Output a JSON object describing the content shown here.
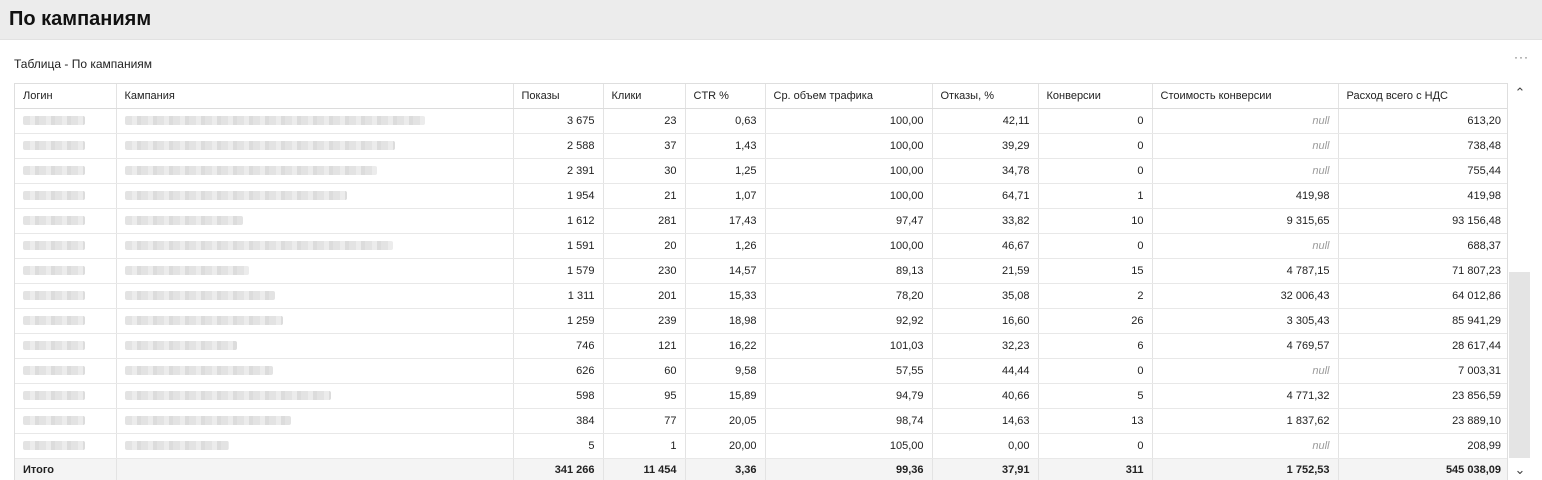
{
  "page": {
    "title": "По кампаниям",
    "subtitle": "Таблица - По кампаниям",
    "more_glyph": "···",
    "scroll_up_glyph": "⌃",
    "scroll_down_glyph": "⌄"
  },
  "table": {
    "columns": [
      "Логин",
      "Кампания",
      "Показы",
      "Клики",
      "CTR %",
      "Ср. объем трафика",
      "Отказы, %",
      "Конверсии",
      "Стоимость конверсии",
      "Расход всего с НДС"
    ],
    "rows": [
      {
        "login": "",
        "campaign": "",
        "shows": "3 675",
        "clicks": "23",
        "ctr": "0,63",
        "traffic": "100,00",
        "bounce": "42,11",
        "conversions": "0",
        "conv_cost": "null",
        "spend": "613,20"
      },
      {
        "login": "",
        "campaign": "",
        "shows": "2 588",
        "clicks": "37",
        "ctr": "1,43",
        "traffic": "100,00",
        "bounce": "39,29",
        "conversions": "0",
        "conv_cost": "null",
        "spend": "738,48"
      },
      {
        "login": "",
        "campaign": "",
        "shows": "2 391",
        "clicks": "30",
        "ctr": "1,25",
        "traffic": "100,00",
        "bounce": "34,78",
        "conversions": "0",
        "conv_cost": "null",
        "spend": "755,44"
      },
      {
        "login": "",
        "campaign": "",
        "shows": "1 954",
        "clicks": "21",
        "ctr": "1,07",
        "traffic": "100,00",
        "bounce": "64,71",
        "conversions": "1",
        "conv_cost": "419,98",
        "spend": "419,98"
      },
      {
        "login": "",
        "campaign": "",
        "shows": "1 612",
        "clicks": "281",
        "ctr": "17,43",
        "traffic": "97,47",
        "bounce": "33,82",
        "conversions": "10",
        "conv_cost": "9 315,65",
        "spend": "93 156,48"
      },
      {
        "login": "",
        "campaign": "",
        "shows": "1 591",
        "clicks": "20",
        "ctr": "1,26",
        "traffic": "100,00",
        "bounce": "46,67",
        "conversions": "0",
        "conv_cost": "null",
        "spend": "688,37"
      },
      {
        "login": "",
        "campaign": "",
        "shows": "1 579",
        "clicks": "230",
        "ctr": "14,57",
        "traffic": "89,13",
        "bounce": "21,59",
        "conversions": "15",
        "conv_cost": "4 787,15",
        "spend": "71 807,23"
      },
      {
        "login": "",
        "campaign": "",
        "shows": "1 311",
        "clicks": "201",
        "ctr": "15,33",
        "traffic": "78,20",
        "bounce": "35,08",
        "conversions": "2",
        "conv_cost": "32 006,43",
        "spend": "64 012,86"
      },
      {
        "login": "",
        "campaign": "",
        "shows": "1 259",
        "clicks": "239",
        "ctr": "18,98",
        "traffic": "92,92",
        "bounce": "16,60",
        "conversions": "26",
        "conv_cost": "3 305,43",
        "spend": "85 941,29"
      },
      {
        "login": "",
        "campaign": "",
        "shows": "746",
        "clicks": "121",
        "ctr": "16,22",
        "traffic": "101,03",
        "bounce": "32,23",
        "conversions": "6",
        "conv_cost": "4 769,57",
        "spend": "28 617,44"
      },
      {
        "login": "",
        "campaign": "",
        "shows": "626",
        "clicks": "60",
        "ctr": "9,58",
        "traffic": "57,55",
        "bounce": "44,44",
        "conversions": "0",
        "conv_cost": "null",
        "spend": "7 003,31"
      },
      {
        "login": "",
        "campaign": "",
        "shows": "598",
        "clicks": "95",
        "ctr": "15,89",
        "traffic": "94,79",
        "bounce": "40,66",
        "conversions": "5",
        "conv_cost": "4 771,32",
        "spend": "23 856,59"
      },
      {
        "login": "",
        "campaign": "",
        "shows": "384",
        "clicks": "77",
        "ctr": "20,05",
        "traffic": "98,74",
        "bounce": "14,63",
        "conversions": "13",
        "conv_cost": "1 837,62",
        "spend": "23 889,10"
      },
      {
        "login": "",
        "campaign": "",
        "shows": "5",
        "clicks": "1",
        "ctr": "20,00",
        "traffic": "105,00",
        "bounce": "0,00",
        "conversions": "0",
        "conv_cost": "null",
        "spend": "208,99"
      }
    ],
    "total": {
      "label": "Итого",
      "shows": "341 266",
      "clicks": "11 454",
      "ctr": "3,36",
      "traffic": "99,36",
      "bounce": "37,91",
      "conversions": "311",
      "conv_cost": "1 752,53",
      "spend": "545 038,09"
    }
  },
  "colors": {
    "header_bg": "#ececec",
    "footer_bg": "#f4f4f4",
    "null_text": "#9a9a9a",
    "scroll_thumb": "#e4e4e4"
  }
}
